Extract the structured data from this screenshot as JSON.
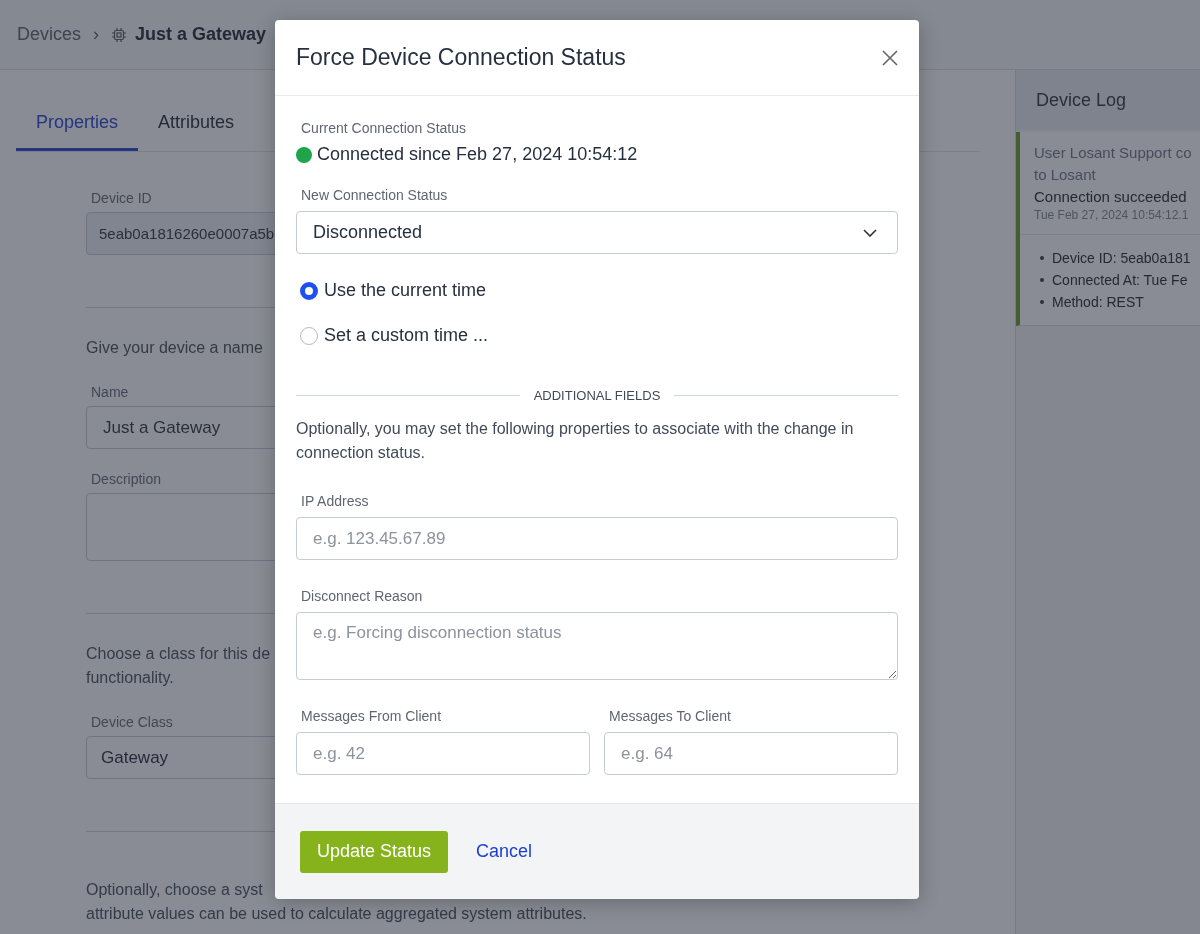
{
  "breadcrumb": {
    "parent": "Devices",
    "separator": "›",
    "current": "Just a Gateway"
  },
  "tabs": [
    {
      "label": "Properties",
      "selected": true
    },
    {
      "label": "Attributes",
      "selected": false
    }
  ],
  "properties": {
    "device_id_label": "Device ID",
    "device_id": "5eab0a1816260e0007a5b",
    "name_intro": "Give your device a name",
    "name_label": "Name",
    "name_value": "Just a Gateway",
    "description_label": "Description",
    "class_intro": [
      "Choose a class for this de",
      "functionality."
    ],
    "class_label": "Device Class",
    "class_value": "Gateway",
    "system_intro": [
      "Optionally, choose a syst",
      "attribute values can be used to calculate aggregated system attributes."
    ]
  },
  "device_log": {
    "title": "Device Log",
    "message": [
      "User Losant Support co",
      "to Losant"
    ],
    "event": "Connection succeeded",
    "time": "Tue Feb 27, 2024 10:54:12.1",
    "details": [
      "Device ID: 5eab0a181",
      "Connected At: Tue Fe",
      "Method: REST"
    ]
  },
  "modal": {
    "title": "Force Device Connection Status",
    "current_label": "Current Connection Status",
    "current_text": "Connected since Feb 27, 2024 10:54:12",
    "connected": true,
    "new_label": "New Connection Status",
    "new_value": "Disconnected",
    "time_options": [
      {
        "label": "Use the current time",
        "selected": true
      },
      {
        "label": "Set a custom time ...",
        "selected": false
      }
    ],
    "section_title": "ADDITIONAL FIELDS",
    "section_text": "Optionally, you may set the following properties to associate with the change in connection status.",
    "fields": [
      {
        "kind": "input",
        "label": "IP Address",
        "placeholder": "e.g. 123.45.67.89"
      },
      {
        "kind": "textarea",
        "label": "Disconnect Reason",
        "placeholder": "e.g. Forcing disconnection status"
      }
    ],
    "message_fields": [
      {
        "label": "Messages From Client",
        "placeholder": "e.g. 42"
      },
      {
        "label": "Messages To Client",
        "placeholder": "e.g. 64"
      }
    ],
    "primary_button": "Update Status",
    "cancel_link": "Cancel"
  }
}
